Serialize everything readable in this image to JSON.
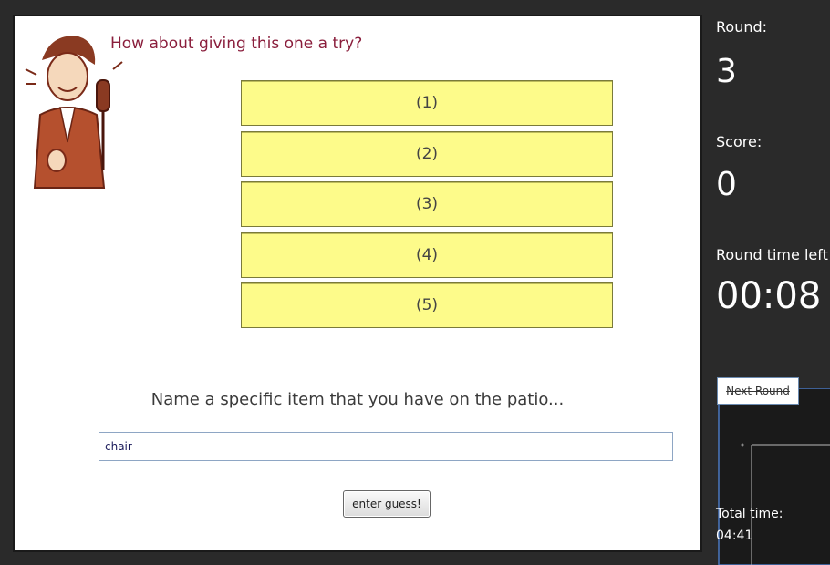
{
  "prompt": "How about giving this one a try?",
  "answers": [
    "(1)",
    "(2)",
    "(3)",
    "(4)",
    "(5)"
  ],
  "question": "Name a specific item that you have on the patio...",
  "guess_input": {
    "value": "chair"
  },
  "enter_button": "enter guess!",
  "sidebar": {
    "round_label": "Round:",
    "round_value": "3",
    "score_label": "Score:",
    "score_value": "0",
    "time_left_label": "Round time left",
    "time_left_value": "00:08",
    "next_round_label": "Next Round",
    "total_label": "Total time:",
    "total_value": "04:41"
  },
  "colors": {
    "answer_bg": "#fdfb8a",
    "prompt": "#8a1e3c",
    "background": "#2a2a2a"
  },
  "icons": [
    "announcer-host-illustration"
  ]
}
